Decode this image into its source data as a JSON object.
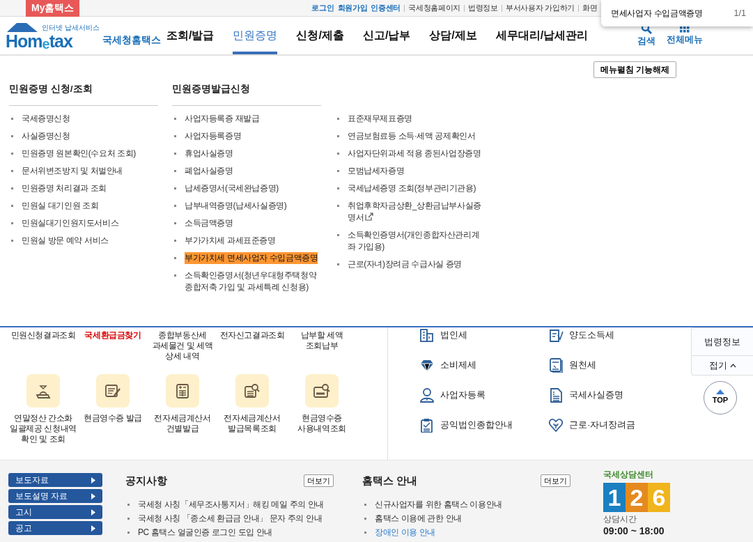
{
  "top_bar": {
    "my_tab": "My홈택스",
    "links": [
      {
        "label": "로그인",
        "emphasis": true
      },
      {
        "label": "회원가입",
        "emphasis": true
      },
      {
        "label": "인증센터",
        "emphasis": true
      },
      {
        "label": "국세청홈페이지",
        "emphasis": false
      },
      {
        "label": "법령정보",
        "emphasis": false
      },
      {
        "label": "부서사용자 가입하기",
        "emphasis": false
      },
      {
        "label": "화면",
        "emphasis": false
      }
    ]
  },
  "find_bar": {
    "value": "면세사업자 수입금액증명",
    "count": "1/1"
  },
  "header": {
    "logo": {
      "tagline": "인터넷 납세서비스",
      "wordmark": "Hom$_{e}$tax",
      "name": "국세청홈택스"
    },
    "nav": [
      {
        "label": "조회/발급",
        "selected": false
      },
      {
        "label": "민원증명",
        "selected": true
      },
      {
        "label": "신청/제출",
        "selected": false
      },
      {
        "label": "신고/납부",
        "selected": false
      },
      {
        "label": "상담/제보",
        "selected": false
      },
      {
        "label": "세무대리/납세관리",
        "selected": false
      }
    ],
    "tools": [
      {
        "label": "검색",
        "kind": "search"
      },
      {
        "label": "전체메뉴",
        "kind": "grid"
      }
    ]
  },
  "mega_menu": {
    "toggle_button": "메뉴펼침 기능해제",
    "columns": [
      {
        "heading": "민원증명 신청/조회",
        "items": [
          {
            "label": "국세증명신청",
            "highlighted": false,
            "external": false
          },
          {
            "label": "사실증명신청",
            "highlighted": false,
            "external": false
          },
          {
            "label": "민원증명 원본확인(수요처 조회)",
            "highlighted": false,
            "external": false
          },
          {
            "label": "문서위변조방지 및 처벌안내",
            "highlighted": false,
            "external": false
          },
          {
            "label": "민원증명 처리결과 조회",
            "highlighted": false,
            "external": false
          },
          {
            "label": "민원실 대기인원 조회",
            "highlighted": false,
            "external": false
          },
          {
            "label": "민원실대기인원지도서비스",
            "highlighted": false,
            "external": false
          },
          {
            "label": "민원실 방문 예약 서비스",
            "highlighted": false,
            "external": false
          }
        ]
      },
      {
        "heading": "민원증명발급신청",
        "items": [
          {
            "label": "사업자등록증 재발급",
            "highlighted": false,
            "external": false
          },
          {
            "label": "사업자등록증명",
            "highlighted": false,
            "external": false
          },
          {
            "label": "휴업사실증명",
            "highlighted": false,
            "external": false
          },
          {
            "label": "폐업사실증명",
            "highlighted": false,
            "external": false
          },
          {
            "label": "납세증명서(국세완납증명)",
            "highlighted": false,
            "external": false
          },
          {
            "label": "납부내역증명(납세사실증명)",
            "highlighted": false,
            "external": false
          },
          {
            "label": "소득금액증명",
            "highlighted": false,
            "external": false
          },
          {
            "label": "부가가치세 과세표준증명",
            "highlighted": false,
            "external": false
          },
          {
            "label": "부가가치세 면세사업자 수입금액증명",
            "highlighted": true,
            "external": false
          },
          {
            "label": "소득확인증명서(청년우대형주택청약종합저축 가입 및 과세특례 신청용)",
            "highlighted": false,
            "external": false
          }
        ]
      },
      {
        "items": [
          {
            "label": "표준재무제표증명",
            "highlighted": false,
            "external": false
          },
          {
            "label": "연금보험료등 소득·세액 공제확인서",
            "highlighted": false,
            "external": false
          },
          {
            "label": "사업자단위과세 적용 종된사업장증명",
            "highlighted": false,
            "external": false
          },
          {
            "label": "모범납세자증명",
            "highlighted": false,
            "external": false
          },
          {
            "label": "국세납세증명 조회(정부관리기관용)",
            "highlighted": false,
            "external": false
          },
          {
            "label": "취업후학자금상환_상환금납부사실증명서",
            "highlighted": false,
            "external": true
          },
          {
            "label": "소득확인증명서(개인종합자산관리계좌 가입용)",
            "highlighted": false,
            "external": false
          },
          {
            "label": "근로(자녀)장려금 수급사실 증명",
            "highlighted": false,
            "external": false
          }
        ]
      }
    ]
  },
  "quick_links": [
    {
      "label": "민원신청결과조회",
      "alert": false
    },
    {
      "label": "국세환급금찾기",
      "alert": true
    },
    {
      "label": "종합부동산세\n과세물건 및 세액\n상세 내역",
      "alert": false
    },
    {
      "label": "전자신고결과조회",
      "alert": false
    },
    {
      "label": "납부할 세액\n조회납부",
      "alert": false
    }
  ],
  "services": [
    {
      "label": "연말정산 간소화\n일괄제공 신청내역\n확인 및 조회",
      "kind": "moneybag"
    },
    {
      "label": "현금영수증 발급",
      "kind": "sign"
    },
    {
      "label": "전자세금계산서\n건별발급",
      "kind": "calculator"
    },
    {
      "label": "전자세금계산서\n발급목록조회",
      "kind": "search-doc"
    },
    {
      "label": "현금영수증\n사용내역조회",
      "kind": "receipt"
    }
  ],
  "tax_links": [
    {
      "label": "법인세",
      "kind": "building"
    },
    {
      "label": "양도소득세",
      "kind": "doc-check"
    },
    {
      "label": "소비제세",
      "kind": "diamond"
    },
    {
      "label": "원천세",
      "kind": "salary"
    },
    {
      "label": "사업자등록",
      "kind": "person"
    },
    {
      "label": "국세사실증명",
      "kind": "document"
    },
    {
      "label": "공익법인종합안내",
      "kind": "clipboard"
    },
    {
      "label": "근로·자녀장려금",
      "kind": "heart"
    }
  ],
  "side_panel": {
    "label": "법령정보",
    "fold": "접기",
    "top": "TOP"
  },
  "footer": {
    "press_buttons": [
      "보도자료",
      "보도설명 자료",
      "고시",
      "공고"
    ],
    "notices": {
      "title": "공지사항",
      "more": "더보기",
      "items": [
        {
          "label": "국세청 사칭「세무조사통지서」해킹 메일 주의 안내",
          "link": false
        },
        {
          "label": "국세청 사칭 「종소세 환급금 안내」 문자 주의 안내",
          "link": false
        },
        {
          "label": "PC 홈택스 얼굴인증 로그인 도입 안내",
          "link": false
        }
      ]
    },
    "guide": {
      "title": "홈택스 안내",
      "more": "더보기",
      "items": [
        {
          "label": "신규사업자를 위한 홈택스 이용안내",
          "link": false
        },
        {
          "label": "홈택스 이용에 관한 안내",
          "link": false
        },
        {
          "label": "장애인 이용 안내",
          "link": true
        }
      ]
    },
    "call_center": {
      "title": "국세상담센터",
      "digits": [
        {
          "text": "1",
          "color": "#1b7fc1"
        },
        {
          "text": "2",
          "color": "#e58a1f"
        },
        {
          "text": "6",
          "color": "#f0b41c"
        }
      ],
      "hours_label": "상담시간",
      "hours": "09:00 ~ 18:00"
    }
  }
}
